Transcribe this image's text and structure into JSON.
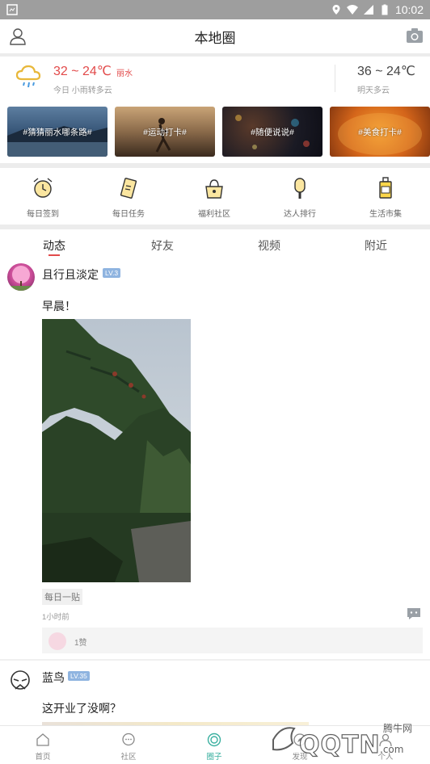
{
  "status_bar": {
    "time": "10:02"
  },
  "header": {
    "title": "本地圈"
  },
  "weather": {
    "today_temp": "32 ~ 24℃",
    "city": "丽水",
    "today_desc": "今日 小雨转多云",
    "tomorrow_temp": "36 ~ 24℃",
    "tomorrow_desc": "明天多云"
  },
  "topics": [
    {
      "label": "#猜猜丽水哪条路#"
    },
    {
      "label": "#运动打卡#"
    },
    {
      "label": "#随便说说#"
    },
    {
      "label": "#美食打卡#"
    }
  ],
  "quick_nav": [
    {
      "label": "每日签到",
      "icon": "alarm-clock-icon"
    },
    {
      "label": "每日任务",
      "icon": "task-card-icon"
    },
    {
      "label": "福利社区",
      "icon": "handbag-icon"
    },
    {
      "label": "达人排行",
      "icon": "popsicle-icon"
    },
    {
      "label": "生活市集",
      "icon": "bottle-icon"
    }
  ],
  "tabs": [
    {
      "label": "动态",
      "active": true
    },
    {
      "label": "好友",
      "active": false
    },
    {
      "label": "视频",
      "active": false
    },
    {
      "label": "附近",
      "active": false
    }
  ],
  "posts": [
    {
      "username": "且行且淡定",
      "level": "LV.3",
      "text": "早晨！",
      "tag": "每日一贴",
      "time_ago": "1小时前",
      "likes": "1赞"
    },
    {
      "username": "蓝鸟",
      "level": "LV.35",
      "text": "这开业了没啊？"
    }
  ],
  "bottom_nav": [
    {
      "label": "首页",
      "icon": "home-icon",
      "active": false
    },
    {
      "label": "社区",
      "icon": "chat-bubble-icon",
      "active": false
    },
    {
      "label": "圈子",
      "icon": "circle-icon",
      "active": true
    },
    {
      "label": "发现",
      "icon": "discover-icon",
      "active": false
    },
    {
      "label": "个人",
      "icon": "profile-icon",
      "active": false
    }
  ],
  "watermark": {
    "text": "腾牛网",
    "brand": "QQTN.com"
  },
  "colors": {
    "accent_red": "#e24a4a",
    "active_teal": "#3ab0a0",
    "level_badge": "#8fb4e0"
  }
}
